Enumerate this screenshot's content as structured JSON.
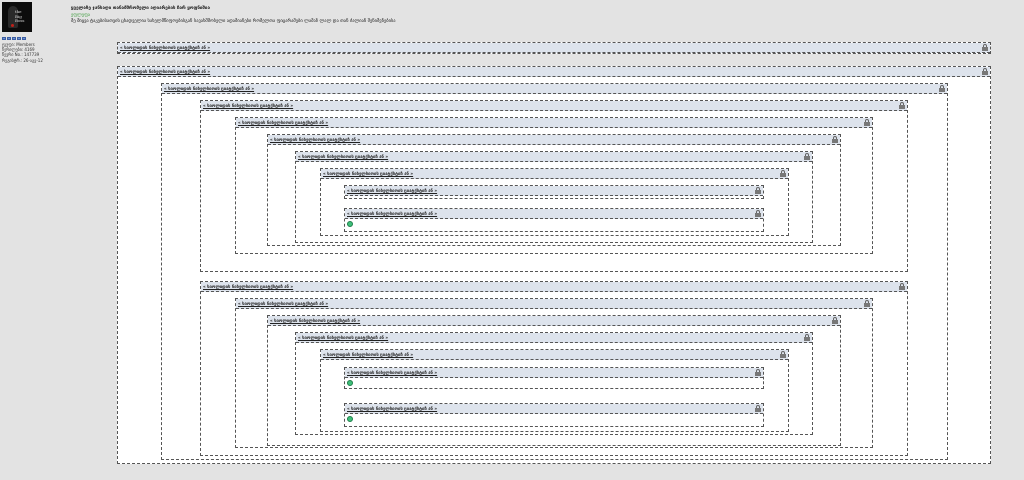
{
  "avatar": {
    "logo_text": "the\nBig\nBoss"
  },
  "user": {
    "rank_stars": 5,
    "lines": [
      "ჯგუფი: Members",
      "წერილები: 4169",
      "წევრი No.: 147739",
      "რეგისტრ.: 26-აგვ-12"
    ]
  },
  "post": {
    "title": "ყველაზე ჯანსაღი თანამშრომელი აღიარების ჩარ ყოფნიშია",
    "subtitle": "ეფლეფა",
    "text": "მე მიყვა ტაკებისათვის ცხადველია სახელმწიფოებისგან სავახშმობელი ადამიანები რომელთა ფიცარამები ლამაზ ლალ და თან ძალიან შენიშვნებისა"
  },
  "quote_title": "« სიოლიდის ნიხელსიოის ციატქსტიჩ ან »",
  "icons": {
    "lock": "lock-icon",
    "smiley": "smiley-icon"
  }
}
